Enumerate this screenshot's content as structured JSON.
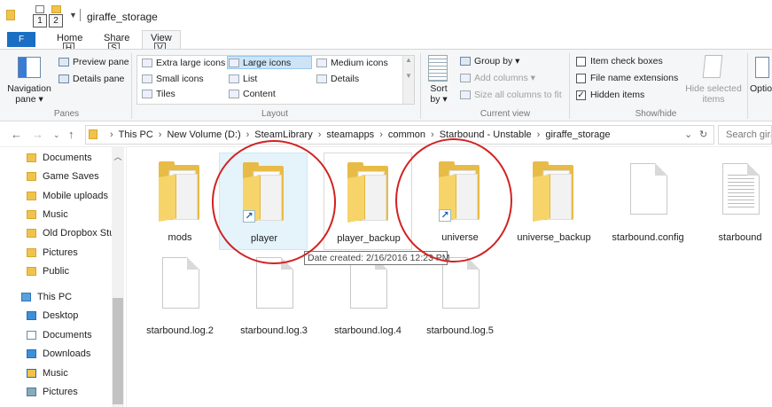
{
  "window": {
    "title": "giraffe_storage",
    "keytips": [
      "1",
      "2"
    ]
  },
  "tabs": {
    "file": "F",
    "home": {
      "label": "Home",
      "keytip": "H"
    },
    "share": {
      "label": "Share",
      "keytip": "S"
    },
    "view": {
      "label": "View",
      "keytip": "V"
    }
  },
  "ribbon": {
    "panes": {
      "navigation_pane": "Navigation\npane ▾",
      "preview_pane": "Preview pane",
      "details_pane": "Details pane",
      "label": "Panes"
    },
    "layout": {
      "items": [
        "Extra large icons",
        "Large icons",
        "Medium icons",
        "Small icons",
        "List",
        "Details",
        "Tiles",
        "Content"
      ],
      "selected": "Large icons",
      "label": "Layout"
    },
    "current_view": {
      "sort_by": "Sort\nby ▾",
      "group_by": "Group by ▾",
      "add_columns": "Add columns ▾",
      "size_columns": "Size all columns to fit",
      "label": "Current view"
    },
    "show_hide": {
      "item_check_boxes": {
        "label": "Item check boxes",
        "checked": false
      },
      "file_name_extensions": {
        "label": "File name extensions",
        "checked": false
      },
      "hidden_items": {
        "label": "Hidden items",
        "checked": true
      },
      "hide_selected": "Hide selected\nitems",
      "label": "Show/hide"
    },
    "options": "Optio"
  },
  "address": {
    "crumbs": [
      "This PC",
      "New Volume (D:)",
      "SteamLibrary",
      "steamapps",
      "common",
      "Starbound - Unstable",
      "giraffe_storage"
    ],
    "search_placeholder": "Search gira"
  },
  "nav_pane": {
    "items": [
      {
        "label": "Documents",
        "icon": "folder-icon"
      },
      {
        "label": "Game Saves",
        "icon": "folder-icon"
      },
      {
        "label": "Mobile uploads",
        "icon": "folder-icon"
      },
      {
        "label": "Music",
        "icon": "folder-icon"
      },
      {
        "label": "Old Dropbox Stu",
        "icon": "folder-icon"
      },
      {
        "label": "Pictures",
        "icon": "folder-icon"
      },
      {
        "label": "Public",
        "icon": "folder-icon"
      },
      {
        "label": "This PC",
        "icon": "computer-icon"
      },
      {
        "label": "Desktop",
        "icon": "desktop-icon"
      },
      {
        "label": "Documents",
        "icon": "documents-icon"
      },
      {
        "label": "Downloads",
        "icon": "downloads-icon"
      },
      {
        "label": "Music",
        "icon": "music-icon"
      },
      {
        "label": "Pictures",
        "icon": "pictures-icon"
      }
    ]
  },
  "files": [
    {
      "name": "mods",
      "type": "folder"
    },
    {
      "name": "player",
      "type": "folder-shortcut"
    },
    {
      "name": "player_backup",
      "type": "folder"
    },
    {
      "name": "universe",
      "type": "folder-shortcut"
    },
    {
      "name": "universe_backup",
      "type": "folder"
    },
    {
      "name": "starbound.config",
      "type": "file"
    },
    {
      "name": "starbound",
      "type": "text-file"
    },
    {
      "name": "starbound.log.2",
      "type": "file"
    },
    {
      "name": "starbound.log.3",
      "type": "file"
    },
    {
      "name": "starbound.log.4",
      "type": "file"
    },
    {
      "name": "starbound.log.5",
      "type": "file"
    }
  ],
  "tooltip": "Date created: 2/16/2016 12:23 PM",
  "annotation_color": "#d22222"
}
